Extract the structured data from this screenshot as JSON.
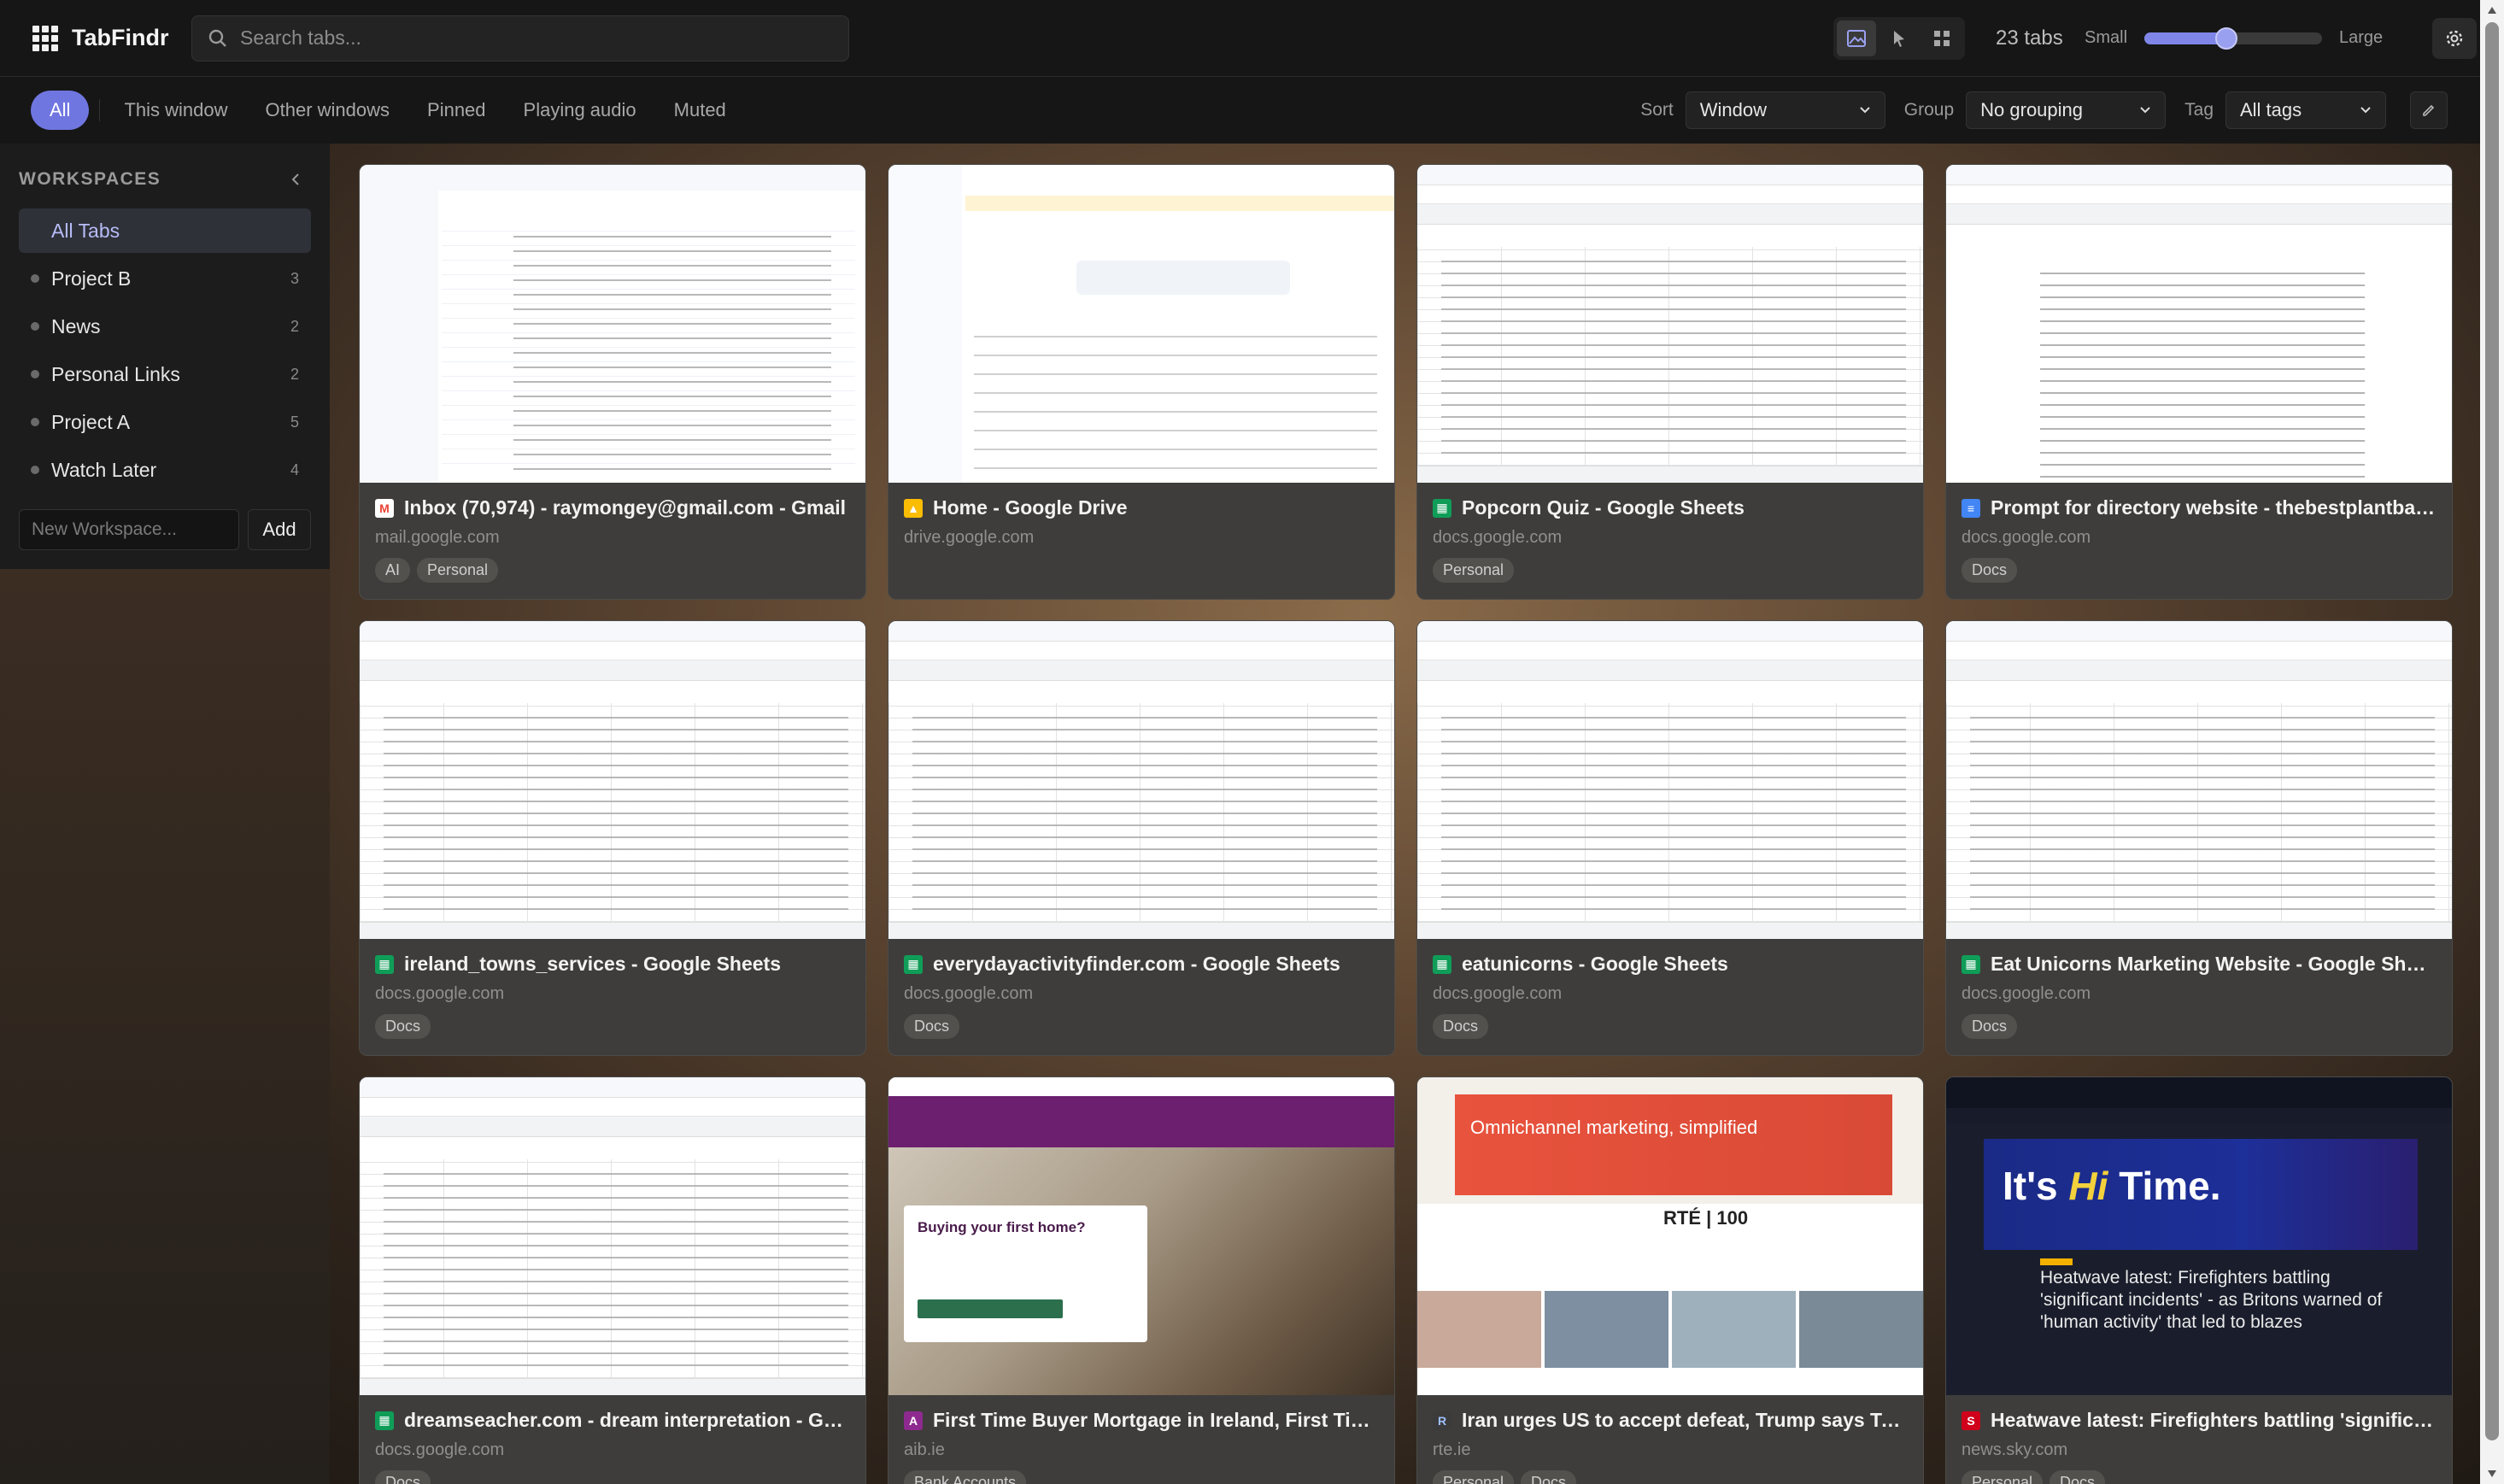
{
  "app": {
    "name": "TabFindr"
  },
  "search": {
    "placeholder": "Search tabs..."
  },
  "header": {
    "tab_count": "23 tabs",
    "size_small": "Small",
    "size_large": "Large",
    "size_value": 0.46
  },
  "filters": [
    {
      "label": "All",
      "active": true
    },
    {
      "label": "This window",
      "active": false
    },
    {
      "label": "Other windows",
      "active": false
    },
    {
      "label": "Pinned",
      "active": false
    },
    {
      "label": "Playing audio",
      "active": false
    },
    {
      "label": "Muted",
      "active": false
    }
  ],
  "controls": {
    "sort_label": "Sort",
    "sort_value": "Window",
    "group_label": "Group",
    "group_value": "No grouping",
    "tag_label": "Tag",
    "tag_value": "All tags"
  },
  "sidebar": {
    "title": "WORKSPACES",
    "items": [
      {
        "name": "All Tabs",
        "count": "",
        "active": true
      },
      {
        "name": "Project B",
        "count": "3",
        "active": false
      },
      {
        "name": "News",
        "count": "2",
        "active": false
      },
      {
        "name": "Personal Links",
        "count": "2",
        "active": false
      },
      {
        "name": "Project A",
        "count": "5",
        "active": false
      },
      {
        "name": "Watch Later",
        "count": "4",
        "active": false
      }
    ],
    "new_placeholder": "New Workspace...",
    "add_label": "Add"
  },
  "colors": {
    "accent": "#7076e0",
    "gmail": "#ea4335",
    "sheets": "#0f9d58",
    "docs": "#4285f4",
    "aib": "#6c1f6e",
    "sky": "#d0021b"
  },
  "tabs": [
    {
      "title": "Inbox (70,974) - raymongey@gmail.com - Gmail",
      "domain": "mail.google.com",
      "tags": [
        "AI",
        "Personal"
      ],
      "favicon": "gmail-icon",
      "thumb": "gmail"
    },
    {
      "title": "Home - Google Drive",
      "domain": "drive.google.com",
      "tags": [],
      "favicon": "drive-icon",
      "thumb": "drive"
    },
    {
      "title": "Popcorn Quiz - Google Sheets",
      "domain": "docs.google.com",
      "tags": [
        "Personal"
      ],
      "favicon": "sheets-icon",
      "thumb": "sheet"
    },
    {
      "title": "Prompt for directory website - thebestplantbase...",
      "domain": "docs.google.com",
      "tags": [
        "Docs"
      ],
      "favicon": "docs-icon",
      "thumb": "doc"
    },
    {
      "title": "ireland_towns_services - Google Sheets",
      "domain": "docs.google.com",
      "tags": [
        "Docs"
      ],
      "favicon": "sheets-icon",
      "thumb": "sheet"
    },
    {
      "title": "everydayactivityfinder.com - Google Sheets",
      "domain": "docs.google.com",
      "tags": [
        "Docs"
      ],
      "favicon": "sheets-icon",
      "thumb": "sheet"
    },
    {
      "title": "eatunicorns - Google Sheets",
      "domain": "docs.google.com",
      "tags": [
        "Docs"
      ],
      "favicon": "sheets-icon",
      "thumb": "sheet"
    },
    {
      "title": "Eat Unicorns Marketing Website - Google Sheets",
      "domain": "docs.google.com",
      "tags": [
        "Docs"
      ],
      "favicon": "sheets-icon",
      "thumb": "sheet"
    },
    {
      "title": "dreamseacher.com - dream interpretation - Goo...",
      "domain": "docs.google.com",
      "tags": [
        "Docs"
      ],
      "favicon": "sheets-icon",
      "thumb": "sheet"
    },
    {
      "title": "First Time Buyer Mortgage in Ireland, First Time ...",
      "domain": "aib.ie",
      "tags": [
        "Bank Accounts"
      ],
      "favicon": "aib-icon",
      "thumb": "aib"
    },
    {
      "title": "Iran urges US to accept defeat, Trump says Tehra...",
      "domain": "rte.ie",
      "tags": [
        "Personal",
        "Docs"
      ],
      "favicon": "rte-icon",
      "thumb": "rte"
    },
    {
      "title": "Heatwave latest: Firefighters battling 'significant ...",
      "domain": "news.sky.com",
      "tags": [
        "Personal",
        "Docs"
      ],
      "favicon": "sky-news-icon",
      "thumb": "sky"
    }
  ],
  "thumb_text": {
    "aib_heading": "Buying your first home?",
    "rte_ad": "Omnichannel marketing, simplified",
    "rte_logo": "RTÉ | 100",
    "sky_hero_a": "It's",
    "sky_hero_b": "Hi",
    "sky_hero_c": "Time.",
    "sky_news": "Heatwave latest: Firefighters battling 'significant incidents' - as Britons warned of 'human activity' that led to blazes"
  }
}
